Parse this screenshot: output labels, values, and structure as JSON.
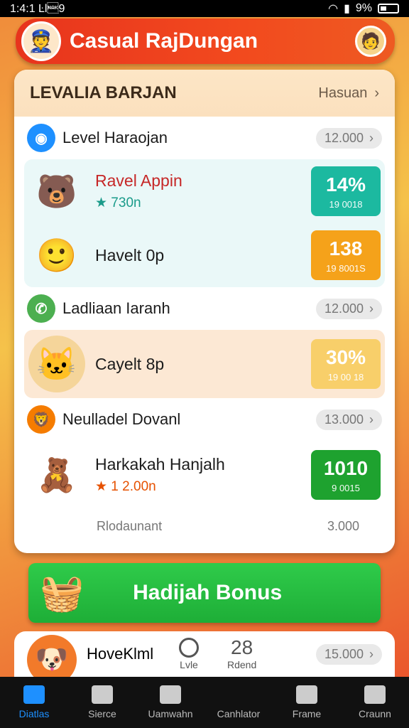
{
  "status": {
    "time": "1:4:1 Ŀl\u00159",
    "battery": "9%"
  },
  "header": {
    "title": "Casual RajDungan"
  },
  "panel": {
    "title": "LEVALIA BARJAN",
    "more_label": "Hasuan",
    "sections": [
      {
        "title": "Level Haraojan",
        "pill": "12.000",
        "color": "#1e90ff",
        "icon": "compass-icon",
        "rows": [
          {
            "name": "Ravel Appin",
            "sub": "★ 730n",
            "sub_color": "#1a9b8a",
            "name_color": "#c62828",
            "badge_big": "14%",
            "badge_small": "19 0018",
            "badge_color": "#1cb9a0",
            "mascot": "🐻"
          },
          {
            "name": "Havelt 0p",
            "sub": "",
            "sub_color": "#333",
            "name_color": "#1c1c1c",
            "badge_big": "138",
            "badge_small": "19 8001S",
            "badge_color": "#f5a21a",
            "mascot": "🙂"
          }
        ]
      },
      {
        "title": "Ladliaan Iaranh",
        "pill": "12.000",
        "color": "#4caf50",
        "icon": "phone-icon",
        "rows": [
          {
            "name": "Cayelt 8p",
            "sub": "",
            "sub_color": "#333",
            "name_color": "#1c1c1c",
            "badge_big": "30%",
            "badge_small": "19 00 18",
            "badge_color": "#f8cf6a",
            "mascot": "🐱"
          }
        ]
      },
      {
        "title": "Neulladel Dovanl",
        "pill": "13.000",
        "color": "#f57c00",
        "icon": "lion-icon",
        "rows": [
          {
            "name": "Harkakah Hanjalh",
            "sub": "★ 1 2.00n",
            "sub_color": "#e65100",
            "name_color": "#1c1c1c",
            "badge_big": "1010",
            "badge_small": "9 0015",
            "badge_color": "#1ea22f",
            "mascot": "🧸"
          }
        ]
      }
    ],
    "footer_label": "Rlodaunant",
    "footer_value": "3.000"
  },
  "bonus": {
    "label": "Hadijah Bonus"
  },
  "bottom_card": {
    "name": "HoveKlml",
    "stat1_cap": "Lvle",
    "stat2_num": "28",
    "stat2_cap": "Rdend",
    "pill": "15.000"
  },
  "nav": {
    "items": [
      {
        "label": "Diatlas"
      },
      {
        "label": "Sierce"
      },
      {
        "label": "Uamwahn"
      },
      {
        "label": "Canhlator"
      },
      {
        "label": "Frame"
      },
      {
        "label": "Craunn"
      }
    ]
  },
  "colors": {
    "accent": "#e8341d",
    "bonus_green": "#2fcb4a",
    "nav_active": "#1e90ff"
  }
}
